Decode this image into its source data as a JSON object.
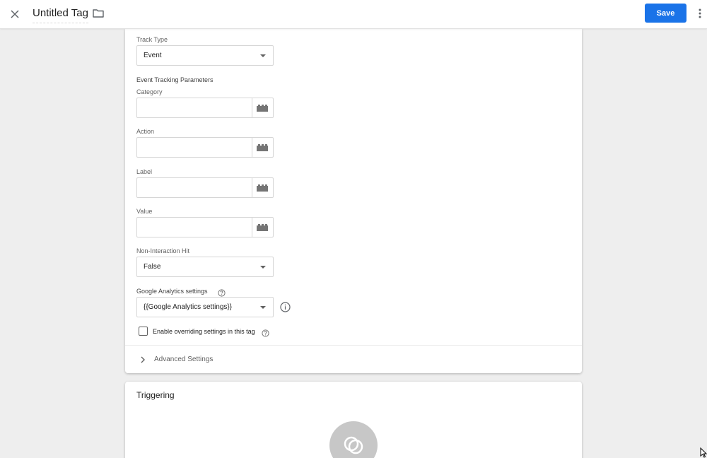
{
  "header": {
    "title": "Untitled Tag",
    "save_label": "Save"
  },
  "config": {
    "track_type": {
      "label": "Track Type",
      "value": "Event"
    },
    "event_params_heading": "Event Tracking Parameters",
    "fields": [
      {
        "label": "Category",
        "value": ""
      },
      {
        "label": "Action",
        "value": ""
      },
      {
        "label": "Label",
        "value": ""
      },
      {
        "label": "Value",
        "value": ""
      }
    ],
    "non_interaction": {
      "label": "Non-Interaction Hit",
      "value": "False"
    },
    "ga_settings": {
      "label": "Google Analytics settings",
      "value": "{{Google Analytics settings}}"
    },
    "override_checkbox": {
      "label": "Enable overriding settings in this tag",
      "checked": false
    },
    "advanced_label": "Advanced Settings"
  },
  "triggering": {
    "title": "Triggering"
  },
  "colors": {
    "accent": "#1a73e8",
    "background": "#eeeeee",
    "card": "#ffffff"
  },
  "icons": [
    "close-icon",
    "folder-icon",
    "more-vert-icon",
    "variable-icon",
    "help-icon",
    "info-icon",
    "chevron-right-icon",
    "trigger-icon"
  ]
}
